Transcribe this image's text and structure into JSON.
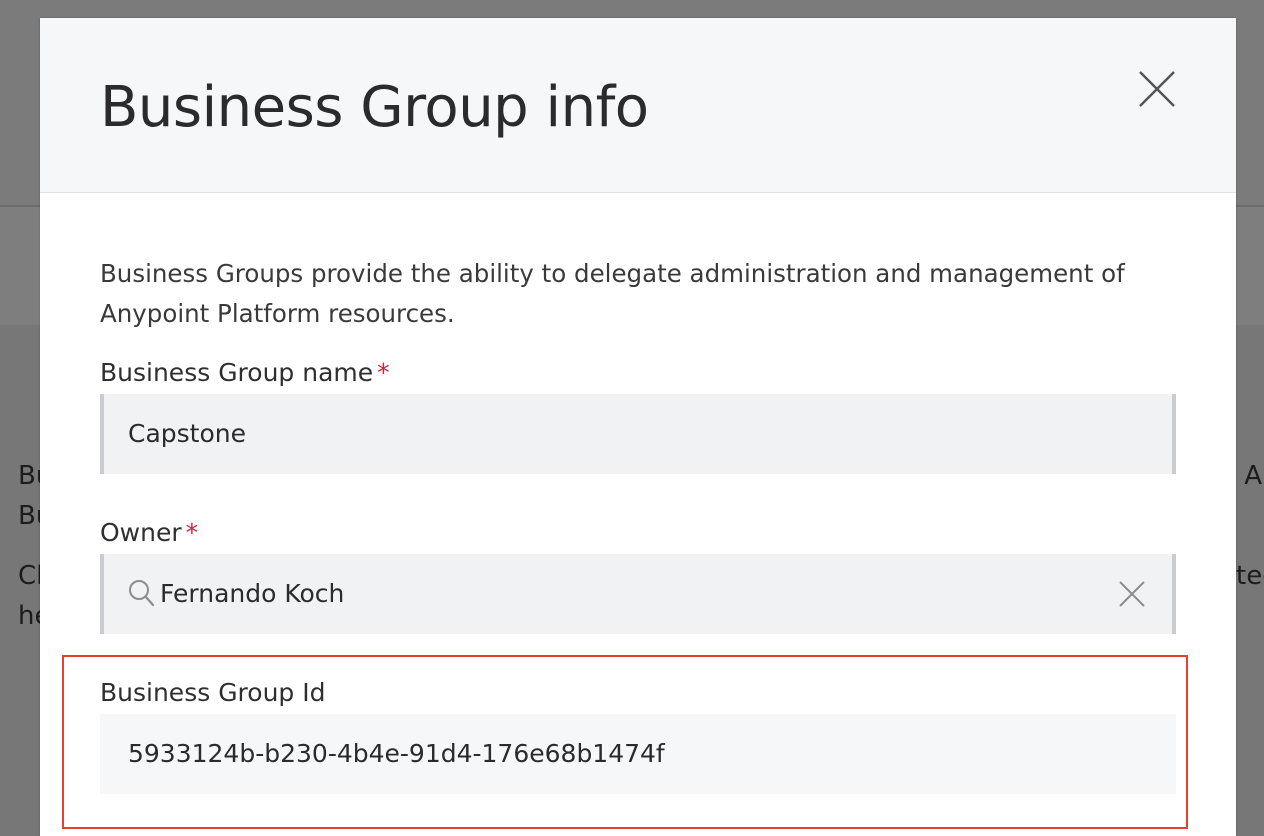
{
  "background": {
    "left_lines": [
      "Bu",
      "Bu",
      "",
      "Cl",
      "he"
    ],
    "right_lines": [
      " A",
      "",
      "",
      "ted",
      ""
    ]
  },
  "modal": {
    "title": "Business Group info",
    "description": "Business Groups provide the ability to delegate administration and management of Anypoint Platform resources.",
    "name_field": {
      "label": "Business Group name",
      "required_mark": "*",
      "value": "Capstone"
    },
    "owner_field": {
      "label": "Owner",
      "required_mark": "*",
      "value": "Fernando Koch",
      "search_icon": "search-icon",
      "clear_icon": "close-icon"
    },
    "id_field": {
      "label": "Business Group Id",
      "value": "5933124b-b230-4b4e-91d4-176e68b1474f"
    },
    "close_icon": "close-icon"
  },
  "colors": {
    "required": "#d0223a",
    "highlight": "#e8402a",
    "overlay": "#7d7d7d"
  }
}
